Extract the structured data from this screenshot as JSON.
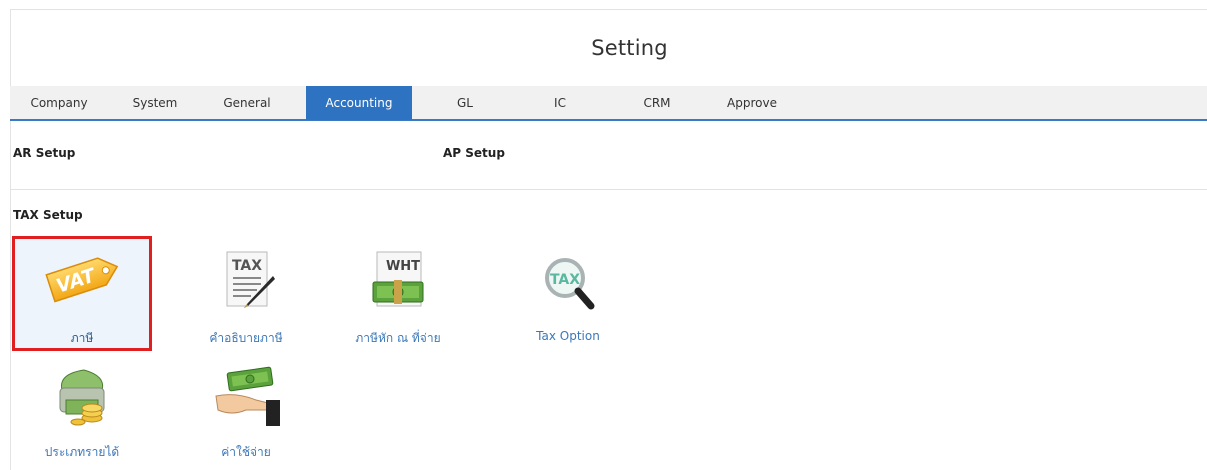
{
  "header": {
    "title": "Setting"
  },
  "tabs": [
    {
      "label": "Company"
    },
    {
      "label": "System"
    },
    {
      "label": "General"
    },
    {
      "label": "Accounting"
    },
    {
      "label": "GL"
    },
    {
      "label": "IC"
    },
    {
      "label": "CRM"
    },
    {
      "label": "Approve"
    }
  ],
  "active_tab": "Accounting",
  "sections": {
    "ar_setup": "AR Setup",
    "ap_setup": "AP Setup",
    "tax_setup": "TAX Setup"
  },
  "tiles": [
    {
      "label": "ภาษี",
      "icon_text": "VAT",
      "icon": "vat-tag-icon"
    },
    {
      "label": "คำอธิบายภาษี",
      "icon_text": "TAX",
      "icon": "tax-document-pen-icon"
    },
    {
      "label": "ภาษีหัก ณ ที่จ่าย",
      "icon_text": "WHT",
      "icon": "wht-money-icon"
    },
    {
      "label": "Tax Option",
      "icon_text": "TAX",
      "icon": "tax-magnifier-icon"
    },
    {
      "label": "ประเภทรายได้",
      "icon": "income-money-coins-icon"
    },
    {
      "label": "ค่าใช้จ่าย",
      "icon": "expense-hand-money-icon"
    }
  ],
  "colors": {
    "accent": "#2e73c2",
    "link": "#3c78b8",
    "highlight": "#e02020"
  }
}
